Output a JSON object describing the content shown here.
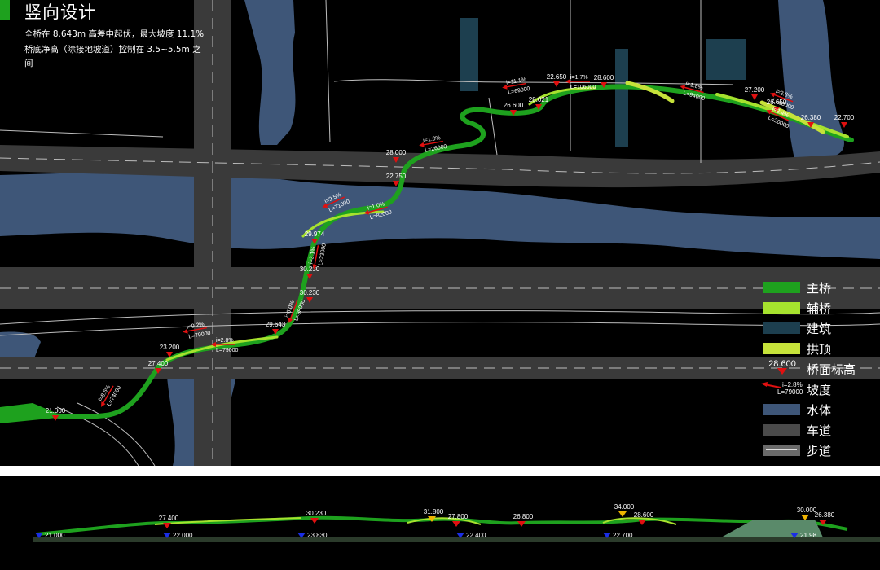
{
  "header": {
    "title": "竖向设计",
    "desc_line1": "全桥在 8.643m 高差中起伏，最大坡度 11.1%",
    "desc_line2": "桥底净高（除接地坡道）控制在 3.5~5.5m 之",
    "desc_line3": "间"
  },
  "colors": {
    "main_bridge": "#1ea11e",
    "aux_bridge": "#a6e22e",
    "building": "#1d3f4f",
    "arch_top": "#c6e23a",
    "water": "#3e5678",
    "road": "#4a4a4a",
    "walk": "#6a6a6a",
    "marker_red": "#e01010",
    "marker_blue": "#1a2ee6",
    "marker_yellow": "#f0b400"
  },
  "legend": {
    "main_bridge": "主桥",
    "aux_bridge": "辅桥",
    "building": "建筑",
    "arch_top": "拱顶",
    "elevation_sample": "28.600",
    "elevation": "桥面标高",
    "slope_i": "i=2.8%",
    "slope_l": "L=79000",
    "slope": "坡度",
    "water": "水体",
    "road": "车道",
    "walk": "步道"
  },
  "plan_elevations": [
    "21.000",
    "27.400",
    "23.200",
    "29.643",
    "30.230",
    "30.230",
    "29.974",
    "22.750",
    "28.000",
    "26.600",
    "28.021",
    "22.650",
    "28.600",
    "27.200",
    "26.650",
    "26.380",
    "22.700"
  ],
  "plan_slopes": [
    {
      "i": "i=8.6%",
      "l": "L=74000"
    },
    {
      "i": "i=9.2%",
      "l": "L=70000"
    },
    {
      "i": "i=2.8%",
      "l": "L=79000"
    },
    {
      "i": "i=6.0%",
      "l": "L=98000"
    },
    {
      "i": "i=3.1%",
      "l": "L=23000"
    },
    {
      "i": "i=9.5%",
      "l": "L=71000"
    },
    {
      "i": "i=1.0%",
      "l": "L=82000"
    },
    {
      "i": "i=1.0%",
      "l": "L=26000"
    },
    {
      "i": "i=11.1%",
      "l": "L=69000"
    },
    {
      "i": "i=1.7%",
      "l": "L=106000"
    },
    {
      "i": "i=1.8%",
      "l": "L=94000"
    },
    {
      "i": "i=2.8%",
      "l": "L=58000"
    },
    {
      "i": "i=2.4%",
      "l": "L=20000"
    }
  ],
  "profile_labels": {
    "red": [
      "27.400",
      "30.230",
      "27.800",
      "26.800",
      "28.600",
      "26.380"
    ],
    "blue": [
      "21.000",
      "22.000",
      "23.830",
      "22.400",
      "22.700",
      "21.98"
    ],
    "yellow": [
      "31.800",
      "34.000",
      "30.000"
    ]
  }
}
